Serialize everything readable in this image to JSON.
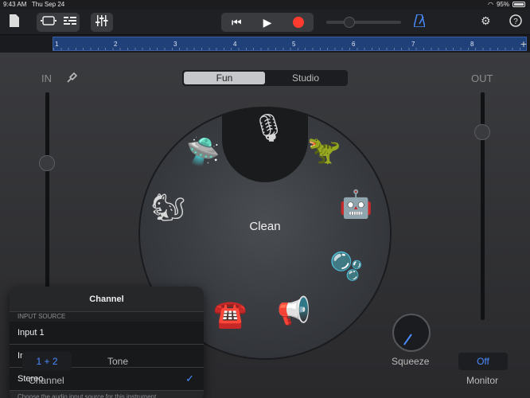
{
  "status": {
    "time": "9:43 AM",
    "date": "Thu Sep 24",
    "battery": "95%"
  },
  "ruler": {
    "bars": [
      "1",
      "2",
      "3",
      "4",
      "5",
      "6",
      "7",
      "8"
    ]
  },
  "tabs": [
    {
      "label": "Fun",
      "active": true
    },
    {
      "label": "Studio",
      "active": false
    }
  ],
  "meters": {
    "in_label": "IN",
    "out_label": "OUT"
  },
  "wheel": {
    "center_label": "Clean",
    "presets": [
      "microphone-icon",
      "monster-icon",
      "robot-icon",
      "bubbles-icon",
      "megaphone-icon",
      "telephone-icon",
      "squirrel-icon",
      "ufo-icon"
    ]
  },
  "popover": {
    "title": "Channel",
    "section": "INPUT SOURCE",
    "items": [
      {
        "label": "Input 1"
      },
      {
        "label": "Input 2"
      },
      {
        "label": "Stereo",
        "selected": true
      }
    ],
    "footer": "Choose the audio input source for this instrument."
  },
  "controls": {
    "channel_value": "1 + 2",
    "channel_label": "Channel",
    "tone_label": "Tone",
    "squeeze_label": "Squeeze",
    "monitor_value": "Off",
    "monitor_label": "Monitor"
  },
  "colors": {
    "accent": "#4a8cff",
    "record": "#ff3b30",
    "ruler": "#20407a"
  }
}
